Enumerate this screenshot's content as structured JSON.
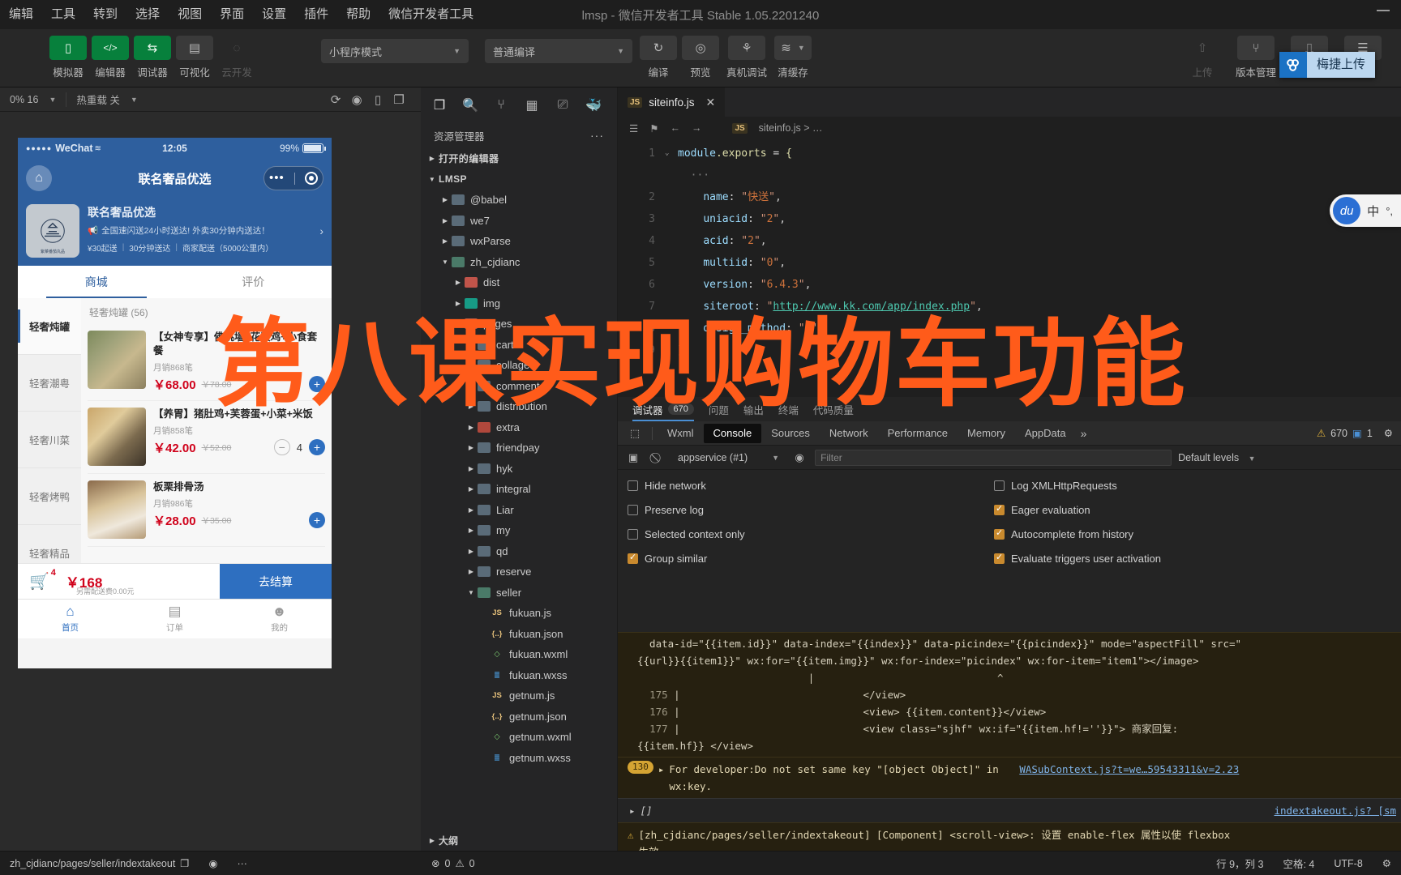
{
  "window": {
    "title": "lmsp - 微信开发者工具 Stable 1.05.2201240",
    "minimize": "—"
  },
  "menubar": {
    "items": [
      "编辑",
      "工具",
      "转到",
      "选择",
      "视图",
      "界面",
      "设置",
      "插件",
      "帮助",
      "微信开发者工具"
    ]
  },
  "toolbar": {
    "left_buttons": [
      {
        "label": "模拟器",
        "icon": "phone-icon",
        "glyph": "▯",
        "state": "active"
      },
      {
        "label": "编辑器",
        "icon": "code-icon",
        "glyph": "</>",
        "state": "active"
      },
      {
        "label": "调试器",
        "icon": "debug-arrows-icon",
        "glyph": "⇆",
        "state": "active"
      },
      {
        "label": "可视化",
        "icon": "layout-icon",
        "glyph": "▤",
        "state": "inactive"
      },
      {
        "label": "云开发",
        "icon": "cloud-icon",
        "glyph": "◌",
        "state": "disabled"
      }
    ],
    "mode_select": "小程序模式",
    "compile_select": "普通编译",
    "mid_buttons": [
      {
        "label": "编译",
        "icon": "refresh-icon",
        "glyph": "↻"
      },
      {
        "label": "预览",
        "icon": "eye-icon",
        "glyph": "◎"
      },
      {
        "label": "真机调试",
        "icon": "bug-icon",
        "glyph": "🐞"
      },
      {
        "label": "清缓存",
        "icon": "layers-icon",
        "glyph": "≋"
      }
    ],
    "right_buttons": [
      {
        "label": "上传",
        "icon": "upload-icon",
        "glyph": "⇧",
        "state": "disabled"
      },
      {
        "label": "版本管理",
        "icon": "branch-icon",
        "glyph": "⑂",
        "state": "normal"
      },
      {
        "label": "测试号",
        "icon": "chart-icon",
        "glyph": "⎍",
        "state": "normal"
      },
      {
        "label": "详情",
        "icon": "list-icon",
        "glyph": "☰",
        "state": "normal"
      }
    ]
  },
  "ime_popup": {
    "logo": "搜狗-logo-icon",
    "text": "梅捷上传"
  },
  "simulator": {
    "bar": {
      "zoom": "0% 16",
      "hot_reload": "热重载 关",
      "icons": [
        "rotate-icon",
        "record-icon",
        "device-icon",
        "copy-icon"
      ]
    },
    "phone": {
      "status": {
        "carrier": "WeChat",
        "dots": "●●●●●",
        "wifi": "📶",
        "time": "12:05",
        "battery": "99%"
      },
      "navbar": {
        "home_icon": "home-icon",
        "title": "联名奢品优选",
        "capsule_dots": "•••",
        "capsule_target": "target-icon"
      },
      "shop": {
        "logo_caption": "紫菜番茄丸品",
        "name": "联名奢品优选",
        "notice_icon": "horn-icon",
        "notice": "全国速闪送24小时送达! 外卖30分钟内送达！",
        "delivery": [
          "¥30起送",
          "30分钟送达",
          "商家配送（5000公里内）"
        ],
        "arrow": "›"
      },
      "tabs": [
        {
          "label": "商城",
          "active": true
        },
        {
          "label": "评价",
          "active": false
        }
      ],
      "categories": [
        {
          "label": "轻奢炖罐",
          "active": true
        },
        {
          "label": "轻奢潮粤",
          "active": false
        },
        {
          "label": "轻奢川菜",
          "active": false
        },
        {
          "label": "轻奢烤鸭",
          "active": false
        },
        {
          "label": "轻奢精品",
          "active": false
        }
      ],
      "group_title": "轻奢炖罐 (56)",
      "goods": [
        {
          "name": "【女神专享】佛跳墙+花胶鸡+小食套餐",
          "sold": "月销868笔",
          "price": "￥68.00",
          "old": "￥78.00",
          "qty": null,
          "add": "+"
        },
        {
          "name": "【养胃】猪肚鸡+芙蓉蛋+小菜+米饭",
          "sold": "月销858笔",
          "price": "￥42.00",
          "old": "￥52.00",
          "qty": "4",
          "add": "+"
        },
        {
          "name": "板栗排骨汤",
          "sold": "月销986笔",
          "price": "￥28.00",
          "old": "￥35.00",
          "qty": null,
          "add": "+"
        }
      ],
      "cart": {
        "icon": "cart-icon",
        "badge": "4",
        "total": "￥168",
        "sub": "另需配送费0.00元",
        "settle": "去结算"
      },
      "tabbar": [
        {
          "label": "首页",
          "icon": "home-tab-icon",
          "glyph": "⌂",
          "active": true
        },
        {
          "label": "订单",
          "icon": "order-tab-icon",
          "glyph": "▤",
          "active": false
        },
        {
          "label": "我的",
          "icon": "profile-tab-icon",
          "glyph": "☻",
          "active": false
        }
      ]
    }
  },
  "explorer": {
    "icons": [
      "files-icon",
      "search-icon",
      "source-control-icon",
      "extensions-icon",
      "debug-icon",
      "docker-icon"
    ],
    "title": "资源管理器",
    "more": "···",
    "sections": [
      {
        "label": "打开的编辑器",
        "expanded": false
      },
      {
        "label": "LMSP",
        "expanded": true
      }
    ],
    "tree": [
      {
        "label": "@babel",
        "type": "folder",
        "depth": 1,
        "expanded": false,
        "color": "#5a6b78"
      },
      {
        "label": "we7",
        "type": "folder",
        "depth": 1,
        "expanded": false,
        "color": "#5a6b78"
      },
      {
        "label": "wxParse",
        "type": "folder",
        "depth": 1,
        "expanded": false,
        "color": "#5a6b78"
      },
      {
        "label": "zh_cjdianc",
        "type": "folder",
        "depth": 1,
        "expanded": true,
        "color": "#4a7a68"
      },
      {
        "label": "dist",
        "type": "folder",
        "depth": 2,
        "expanded": false,
        "color": "#c0544a"
      },
      {
        "label": "img",
        "type": "folder",
        "depth": 2,
        "expanded": false,
        "color": "#179b86"
      },
      {
        "label": "pages",
        "type": "folder",
        "depth": 2,
        "expanded": true,
        "color": "#b05a4a"
      },
      {
        "label": "cart",
        "type": "folder",
        "depth": 3,
        "expanded": false,
        "color": "#5a6b78"
      },
      {
        "label": "collage",
        "type": "folder",
        "depth": 3,
        "expanded": false,
        "color": "#5a6b78"
      },
      {
        "label": "comment",
        "type": "folder",
        "depth": 3,
        "expanded": false,
        "color": "#5a6b78"
      },
      {
        "label": "distribution",
        "type": "folder",
        "depth": 3,
        "expanded": false,
        "color": "#5a6b78"
      },
      {
        "label": "extra",
        "type": "folder",
        "depth": 3,
        "expanded": false,
        "color": "#b0483c"
      },
      {
        "label": "friendpay",
        "type": "folder",
        "depth": 3,
        "expanded": false,
        "color": "#5a6b78"
      },
      {
        "label": "hyk",
        "type": "folder",
        "depth": 3,
        "expanded": false,
        "color": "#5a6b78"
      },
      {
        "label": "integral",
        "type": "folder",
        "depth": 3,
        "expanded": false,
        "color": "#5a6b78"
      },
      {
        "label": "Liar",
        "type": "folder",
        "depth": 3,
        "expanded": false,
        "color": "#5a6b78"
      },
      {
        "label": "my",
        "type": "folder",
        "depth": 3,
        "expanded": false,
        "color": "#5a6b78"
      },
      {
        "label": "qd",
        "type": "folder",
        "depth": 3,
        "expanded": false,
        "color": "#5a6b78"
      },
      {
        "label": "reserve",
        "type": "folder",
        "depth": 3,
        "expanded": false,
        "color": "#5a6b78"
      },
      {
        "label": "seller",
        "type": "folder",
        "depth": 3,
        "expanded": true,
        "color": "#4a7a68"
      },
      {
        "label": "fukuan.js",
        "type": "js",
        "depth": 4
      },
      {
        "label": "fukuan.json",
        "type": "json",
        "depth": 4
      },
      {
        "label": "fukuan.wxml",
        "type": "wxml",
        "depth": 4
      },
      {
        "label": "fukuan.wxss",
        "type": "wxss",
        "depth": 4
      },
      {
        "label": "getnum.js",
        "type": "js",
        "depth": 4
      },
      {
        "label": "getnum.json",
        "type": "json",
        "depth": 4
      },
      {
        "label": "getnum.wxml",
        "type": "wxml",
        "depth": 4
      },
      {
        "label": "getnum.wxss",
        "type": "wxss",
        "depth": 4
      }
    ],
    "outline": "大纲"
  },
  "editor": {
    "tab": {
      "label": "siteinfo.js",
      "icon": "js-icon",
      "close": "✕"
    },
    "breadcrumb_icons": [
      "outline-icon",
      "bookmark-icon",
      "back-arrow-icon",
      "forward-arrow-icon"
    ],
    "breadcrumb": "siteinfo.js  >  …",
    "lines": [
      {
        "no": "1",
        "fold": "⌄",
        "text": "module.exports = {"
      },
      {
        "no": "",
        "fold": "",
        "text": "  ···"
      },
      {
        "no": "2",
        "fold": "",
        "text": "    name: \"快送\","
      },
      {
        "no": "3",
        "fold": "",
        "text": "    uniacid: \"2\","
      },
      {
        "no": "4",
        "fold": "",
        "text": "    acid: \"2\","
      },
      {
        "no": "5",
        "fold": "",
        "text": "    multiid: \"0\","
      },
      {
        "no": "6",
        "fold": "",
        "text": "    version: \"6.4.3\","
      },
      {
        "no": "7",
        "fold": "",
        "text": "    siteroot: \"http://www.kk.com/app/index.php\","
      },
      {
        "no": "8",
        "fold": "",
        "text": "    design_method: \"3\""
      },
      {
        "no": "9",
        "fold": "",
        "text": "};"
      }
    ]
  },
  "du_widget": {
    "logo": "du",
    "text1": "中",
    "text2": "°,"
  },
  "devtools": {
    "top_tabs": [
      {
        "label": "调试器",
        "count": "670",
        "active": true
      },
      {
        "label": "问题",
        "count": "",
        "active": false
      },
      {
        "label": "输出",
        "count": "",
        "active": false
      },
      {
        "label": "终端",
        "count": "",
        "active": false
      },
      {
        "label": "代码质量",
        "count": "",
        "active": false
      }
    ],
    "tabs": [
      {
        "label": "Wxml",
        "active": false
      },
      {
        "label": "Console",
        "active": true
      },
      {
        "label": "Sources",
        "active": false
      },
      {
        "label": "Network",
        "active": false
      },
      {
        "label": "Performance",
        "active": false
      },
      {
        "label": "Memory",
        "active": false
      },
      {
        "label": "AppData",
        "active": false
      }
    ],
    "more": "»",
    "warning_count": "670",
    "error_count": "1",
    "settings_icon": "gear-icon",
    "console_bar": {
      "sidebar_icon": "sidebar-icon",
      "clear_icon": "clear-icon",
      "context": "appservice (#1)",
      "eye_icon": "eye-icon",
      "filter_placeholder": "Filter",
      "levels": "Default levels"
    },
    "options": [
      {
        "label": "Hide network",
        "checked": false,
        "label_r": "Log XMLHttpRequests",
        "checked_r": false
      },
      {
        "label": "Preserve log",
        "checked": false,
        "label_r": "Eager evaluation",
        "checked_r": true
      },
      {
        "label": "Selected context only",
        "checked": false,
        "label_r": "Autocomplete from history",
        "checked_r": true
      },
      {
        "label": "Group similar",
        "checked": true,
        "label_r": "Evaluate triggers user activation",
        "checked_r": true
      }
    ],
    "logs": {
      "code1": "  data-id=\"{{item.id}}\" data-index=\"{{index}}\" data-picindex=\"{{picindex}}\" mode=\"aspectFill\" src=\"",
      "code2": "{{url}}{{item1}}\" wx:for=\"{{item.img}}\" wx:for-index=\"picindex\" wx:for-item=\"item1\"></image>",
      "caret": "                            |                              ^",
      "l175": {
        "no": "175",
        "text": "</view>"
      },
      "l176": {
        "no": "176",
        "text": "<view> {{item.content}}</view>"
      },
      "l177": {
        "no": "177",
        "text": "<view class=\"sjhf\" wx:if=\"{{item.hf!=''}}\"> 商家回复:"
      },
      "l178": {
        "text": "{{item.hf}} </view>"
      },
      "warn_badge": "130",
      "warn_text": "For developer:Do not set same key \"[object Object]\" in",
      "warn_text2": "wx:key.",
      "warn_link": "WASubContext.js?t=we…59543311&v=2.23",
      "empty_array": "[]",
      "empty_link": "indextakeout.js? [sm",
      "final_warn": "[zh_cjdianc/pages/seller/indextakeout] [Component] <scroll-view>: 设置 enable-flex 属性以使 flexbox",
      "final_warn2": "生效",
      "prompt": ">"
    }
  },
  "statusbar": {
    "path": "zh_cjdianc/pages/seller/indextakeout",
    "copy_icon": "copy-icon",
    "eye_icon": "eye-icon",
    "more": "···",
    "errors": "0",
    "warnings": "0",
    "error_icon": "error-icon",
    "warning_icon": "warning-icon",
    "cursor": "行 9，列 3",
    "spaces": "空格: 4",
    "encoding": "UTF-8",
    "gear": "gear-icon"
  },
  "overlay_title": "第八课实现购物车功能"
}
